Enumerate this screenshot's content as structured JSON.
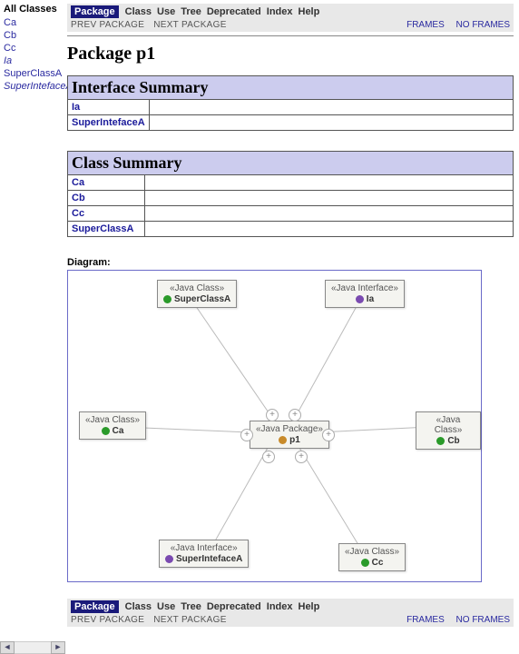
{
  "sidebar": {
    "heading": "All Classes",
    "items": [
      {
        "label": "Ca",
        "italic": false
      },
      {
        "label": "Cb",
        "italic": false
      },
      {
        "label": "Cc",
        "italic": false
      },
      {
        "label": "Ia",
        "italic": true
      },
      {
        "label": "SuperClassA",
        "italic": false
      },
      {
        "label": "SuperIntefaceA",
        "italic": true
      }
    ]
  },
  "nav": {
    "package": "Package",
    "class": "Class",
    "use": "Use",
    "tree": "Tree",
    "deprecated": "Deprecated",
    "index": "Index",
    "help": "Help",
    "prev": "PREV PACKAGE",
    "next": "NEXT PACKAGE",
    "frames": "FRAMES",
    "noframes": "NO FRAMES"
  },
  "title": "Package p1",
  "interface_summary": {
    "heading": "Interface Summary",
    "rows": [
      {
        "name": "Ia"
      },
      {
        "name": "SuperIntefaceA"
      }
    ]
  },
  "class_summary": {
    "heading": "Class Summary",
    "rows": [
      {
        "name": "Ca"
      },
      {
        "name": "Cb"
      },
      {
        "name": "Cc"
      },
      {
        "name": "SuperClassA"
      }
    ]
  },
  "diagram": {
    "label": "Diagram:",
    "nodes": {
      "superclass": {
        "stereo": "«Java Class»",
        "name": "SuperClassA",
        "icon": "class"
      },
      "ia": {
        "stereo": "«Java Interface»",
        "name": "Ia",
        "icon": "int"
      },
      "ca": {
        "stereo": "«Java Class»",
        "name": "Ca",
        "icon": "class"
      },
      "cb": {
        "stereo": "«Java Class»",
        "name": "Cb",
        "icon": "class"
      },
      "p1": {
        "stereo": "«Java Package»",
        "name": "p1",
        "icon": "pkg"
      },
      "superint": {
        "stereo": "«Java Interface»",
        "name": "SuperIntefaceA",
        "icon": "int"
      },
      "cc": {
        "stereo": "«Java Class»",
        "name": "Cc",
        "icon": "class"
      }
    }
  }
}
